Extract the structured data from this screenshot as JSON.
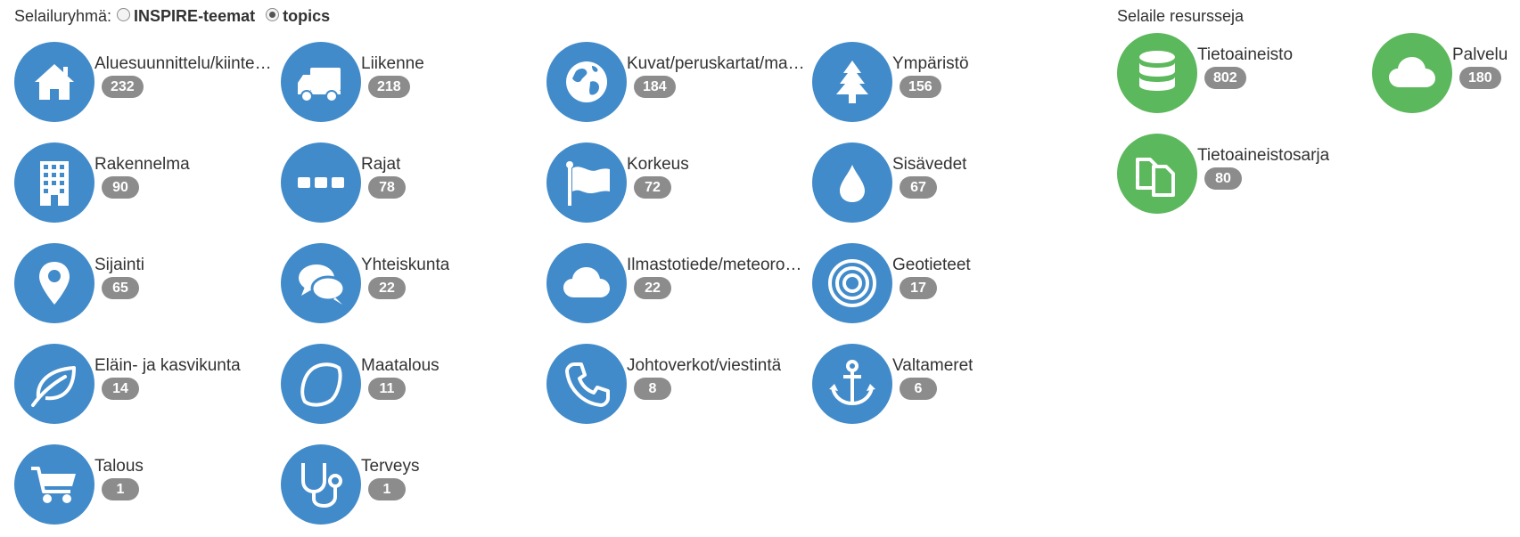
{
  "browse_group": {
    "label": "Selailuryhmä:",
    "options": [
      {
        "label": "INSPIRE-teemat",
        "checked": false
      },
      {
        "label": "topics",
        "checked": true
      }
    ]
  },
  "topics": [
    {
      "label": "Aluesuunnittelu/kiinteistöt",
      "count": "232",
      "icon": "home-icon"
    },
    {
      "label": "Liikenne",
      "count": "218",
      "icon": "truck-icon"
    },
    {
      "label": "Kuvat/peruskartat/maankäyttö",
      "count": "184",
      "icon": "globe-icon"
    },
    {
      "label": "Ympäristö",
      "count": "156",
      "icon": "tree-icon"
    },
    {
      "label": "Rakennelma",
      "count": "90",
      "icon": "building-icon"
    },
    {
      "label": "Rajat",
      "count": "78",
      "icon": "ellipsis-icon"
    },
    {
      "label": "Korkeus",
      "count": "72",
      "icon": "flag-icon"
    },
    {
      "label": "Sisävedet",
      "count": "67",
      "icon": "water-drop-icon"
    },
    {
      "label": "Sijainti",
      "count": "65",
      "icon": "map-pin-icon"
    },
    {
      "label": "Yhteiskunta",
      "count": "22",
      "icon": "comments-icon"
    },
    {
      "label": "Ilmastotiede/meteorologia",
      "count": "22",
      "icon": "cloud-icon"
    },
    {
      "label": "Geotieteet",
      "count": "17",
      "icon": "bullseye-icon"
    },
    {
      "label": "Eläin- ja kasvikunta",
      "count": "14",
      "icon": "leaf-icon"
    },
    {
      "label": "Maatalous",
      "count": "11",
      "icon": "lemon-icon"
    },
    {
      "label": "Johtoverkot/viestintä",
      "count": "8",
      "icon": "phone-icon"
    },
    {
      "label": "Valtameret",
      "count": "6",
      "icon": "anchor-icon"
    },
    {
      "label": "Talous",
      "count": "1",
      "icon": "shopping-cart-icon"
    },
    {
      "label": "Terveys",
      "count": "1",
      "icon": "stethoscope-icon"
    }
  ],
  "resources": {
    "title": "Selaile resursseja",
    "items": [
      {
        "label": "Tietoaineisto",
        "count": "802",
        "icon": "database-icon"
      },
      {
        "label": "Palvelu",
        "count": "180",
        "icon": "cloud-icon"
      },
      {
        "label": "Tietoaineistosarja",
        "count": "80",
        "icon": "copy-files-icon"
      }
    ]
  },
  "colors": {
    "topic_circle": "#428bca",
    "resource_circle": "#5cb85c",
    "badge": "#8c8c8c"
  }
}
